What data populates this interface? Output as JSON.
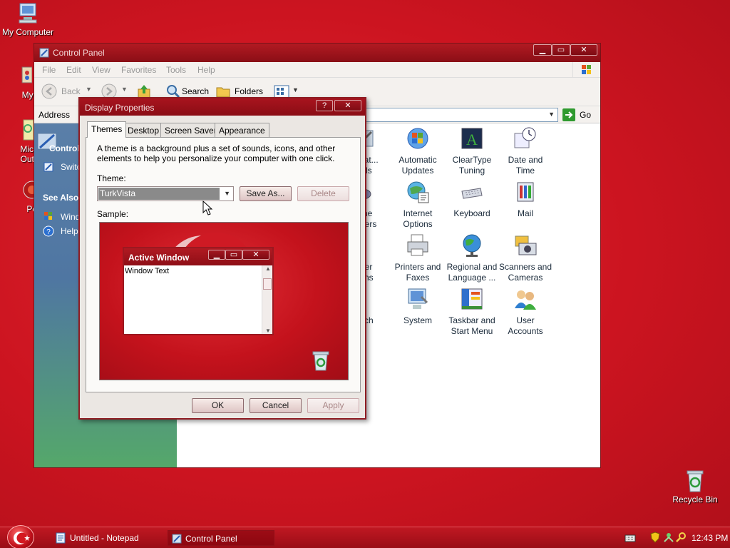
{
  "desktop": {
    "icons": [
      {
        "label": "My Computer",
        "icon": "my-computer-icon"
      },
      {
        "label": "MyPa",
        "icon": "mypaint-icon"
      },
      {
        "label": "Micro",
        "label2": "Outle",
        "icon": "outlook-icon"
      },
      {
        "label": "Peg",
        "icon": "pegasus-icon"
      },
      {
        "label": "Recycle Bin",
        "icon": "recycle-bin-icon"
      }
    ]
  },
  "control_panel": {
    "title": "Control Panel",
    "menu": [
      "File",
      "Edit",
      "View",
      "Favorites",
      "Tools",
      "Help"
    ],
    "toolbar": {
      "back": "Back",
      "search": "Search",
      "folders": "Folders"
    },
    "address_label": "Address",
    "go_label": "Go",
    "left_pane": {
      "header": "Control",
      "switch_link": "Switc",
      "see_also": "See Also",
      "windows_link": "Wind",
      "help_link": "Help"
    },
    "items": [
      {
        "label1": "strat...",
        "label2": "ols",
        "icon": "admin-tools-icon"
      },
      {
        "label1": "Automatic",
        "label2": "Updates",
        "icon": "automatic-updates-icon"
      },
      {
        "label1": "ClearType",
        "label2": "Tuning",
        "icon": "cleartype-icon"
      },
      {
        "label1": "Date and",
        "label2": "Time",
        "icon": "date-time-icon"
      },
      {
        "label1": "me",
        "label2": "ollers",
        "icon": "game-controllers-icon"
      },
      {
        "label1": "Internet",
        "label2": "Options",
        "icon": "internet-options-icon"
      },
      {
        "label1": "Keyboard",
        "label2": "",
        "icon": "keyboard-icon"
      },
      {
        "label1": "Mail",
        "label2": "",
        "icon": "mail-icon"
      },
      {
        "label1": "ver",
        "label2": "ons",
        "icon": "power-options-icon"
      },
      {
        "label1": "Printers and",
        "label2": "Faxes",
        "icon": "printers-icon"
      },
      {
        "label1": "Regional and",
        "label2": "Language ...",
        "icon": "regional-icon"
      },
      {
        "label1": "Scanners and",
        "label2": "Cameras",
        "icon": "scanners-icon"
      },
      {
        "label1": "ech",
        "label2": "",
        "icon": "speech-icon"
      },
      {
        "label1": "System",
        "label2": "",
        "icon": "system-icon"
      },
      {
        "label1": "Taskbar and",
        "label2": "Start Menu",
        "icon": "taskbar-icon"
      },
      {
        "label1": "User",
        "label2": "Accounts",
        "icon": "user-accounts-icon"
      }
    ]
  },
  "display_properties": {
    "title": "Display Properties",
    "tabs": [
      "Themes",
      "Desktop",
      "Screen Saver",
      "Appearance"
    ],
    "description": "A theme is a background plus a set of sounds, icons, and other elements to help you personalize your computer with one click.",
    "theme_label": "Theme:",
    "theme_value": "TurkVista",
    "save_as": "Save As...",
    "delete": "Delete",
    "sample_label": "Sample:",
    "sample_window_title": "Active Window",
    "sample_window_text": "Window Text",
    "ok": "OK",
    "cancel": "Cancel",
    "apply": "Apply"
  },
  "taskbar": {
    "items": [
      "Untitled - Notepad",
      "Control Panel"
    ],
    "clock": "12:43 PM"
  }
}
